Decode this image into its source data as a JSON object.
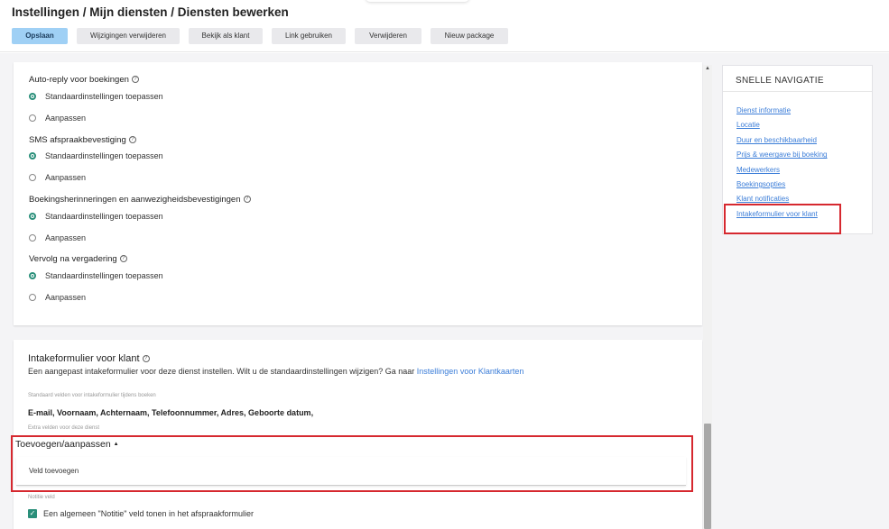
{
  "header": {
    "title": "Instellingen / Mijn diensten / Diensten bewerken",
    "buttons": {
      "save": "Opslaan",
      "discard": "Wijzigingen verwijderen",
      "view_as_client": "Bekijk als klant",
      "use_link": "Link gebruiken",
      "delete": "Verwijderen",
      "new_package": "Nieuw package"
    }
  },
  "settings": {
    "sections": [
      {
        "title": "Auto-reply voor boekingen",
        "opt_default": "Standaardinstellingen toepassen",
        "opt_custom": "Aanpassen"
      },
      {
        "title": "SMS afspraakbevestiging",
        "opt_default": "Standaardinstellingen toepassen",
        "opt_custom": "Aanpassen"
      },
      {
        "title": "Boekingsherinneringen en aanwezigheidsbevestigingen",
        "opt_default": "Standaardinstellingen toepassen",
        "opt_custom": "Aanpassen"
      },
      {
        "title": "Vervolg na vergadering",
        "opt_default": "Standaardinstellingen toepassen",
        "opt_custom": "Aanpassen"
      }
    ]
  },
  "intake": {
    "title": "Intakeformulier voor klant",
    "description": "Een aangepast intakeformulier voor deze dienst instellen. Wilt u de standaardinstellingen wijzigen? Ga naar",
    "description_link": "Instellingen voor Klantkaarten",
    "std_label": "Standaard velden voor intakeformulier tijdens boeken",
    "std_fields": "E-mail, Voornaam, Achternaam, Telefoonnummer, Adres, Geboorte datum,",
    "extra_label": "Extra velden voor deze dienst",
    "add_title": "Toevoegen/aanpassen",
    "add_field": "Veld toevoegen",
    "note_label": "Notitie veld",
    "note_checkbox": "Een algemeen \"Notitie\" veld tonen in het afspraakformulier"
  },
  "quick_nav": {
    "title": "SNELLE NAVIGATIE",
    "links": [
      "Dienst informatie",
      "Locatie",
      "Duur en beschikbaarheid",
      "Prijs & weergave bij boeking",
      "Medewerkers",
      "Boekingsopties",
      "Klant notificaties",
      "Intakeformulier voor klant"
    ]
  },
  "colors": {
    "accent": "#2a8f7a",
    "link": "#3b7dd8",
    "highlight": "#d6282f",
    "primary_button": "#9fd0f5"
  }
}
